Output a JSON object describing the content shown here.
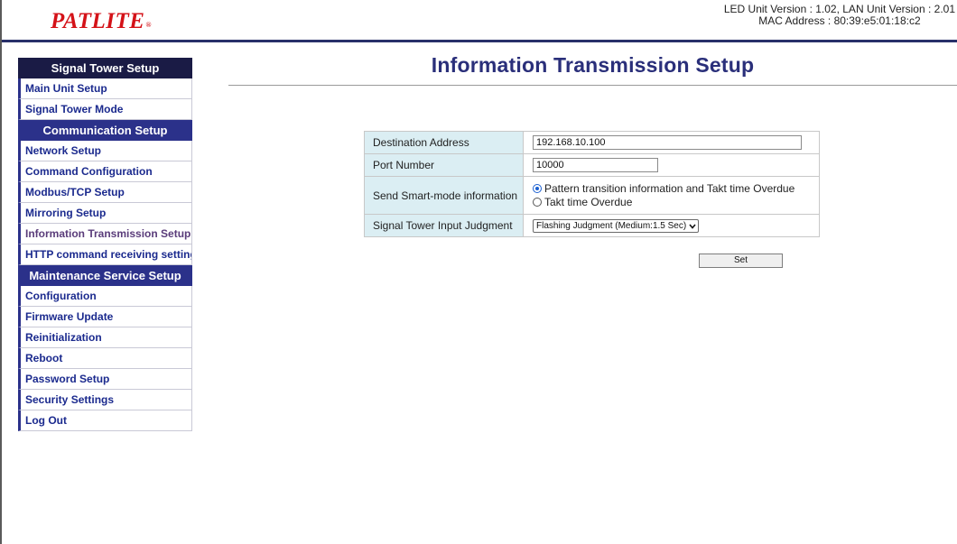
{
  "header": {
    "logo_text": "PATLITE",
    "logo_mark": "®",
    "version_line": "LED Unit Version : 1.02, LAN Unit Version : 2.01",
    "mac_line": "MAC Address : 80:39:e5:01:18:c2"
  },
  "sidebar": {
    "sections": [
      {
        "title": "Signal Tower Setup",
        "items": [
          "Main Unit Setup",
          "Signal Tower Mode"
        ]
      },
      {
        "title": "Communication Setup",
        "items": [
          "Network Setup",
          "Command Configuration",
          "Modbus/TCP Setup",
          "Mirroring Setup",
          "Information Transmission Setup",
          "HTTP command receiving settings"
        ]
      },
      {
        "title": "Maintenance Service Setup",
        "items": [
          "Configuration",
          "Firmware Update",
          "Reinitialization",
          "Reboot",
          "Password Setup",
          "Security Settings",
          "Log Out"
        ]
      }
    ],
    "active_item": "Information Transmission Setup"
  },
  "main": {
    "title": "Information Transmission Setup",
    "form": {
      "destination_label": "Destination Address",
      "destination_value": "192.168.10.100",
      "port_label": "Port Number",
      "port_value": "10000",
      "smart_label": "Send Smart-mode information",
      "smart_option_1": "Pattern transition information and Takt time Overdue",
      "smart_option_2": "Takt time Overdue",
      "smart_selected": 1,
      "judgment_label": "Signal Tower Input Judgment",
      "judgment_value": "Flashing Judgment (Medium:1.5 Sec)"
    },
    "set_label": "Set"
  }
}
